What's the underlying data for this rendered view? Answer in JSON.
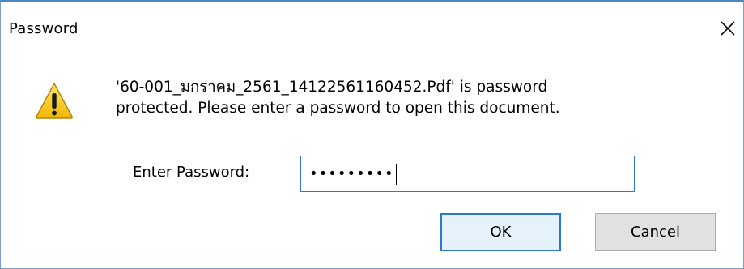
{
  "dialog": {
    "title": "Password",
    "message": "'60-001_มกราคม_2561_14122561160452.Pdf' is password\nprotected. Please enter a password to open this document.",
    "password_label": "Enter Password:",
    "password_value": "•••••••••",
    "ok_label": "OK",
    "cancel_label": "Cancel"
  },
  "icons": {
    "close": "close-icon",
    "warning": "warning-icon"
  },
  "colors": {
    "accent": "#2a78d6",
    "warning_fill": "#f5c518",
    "button_bg": "#e1e1e1"
  }
}
